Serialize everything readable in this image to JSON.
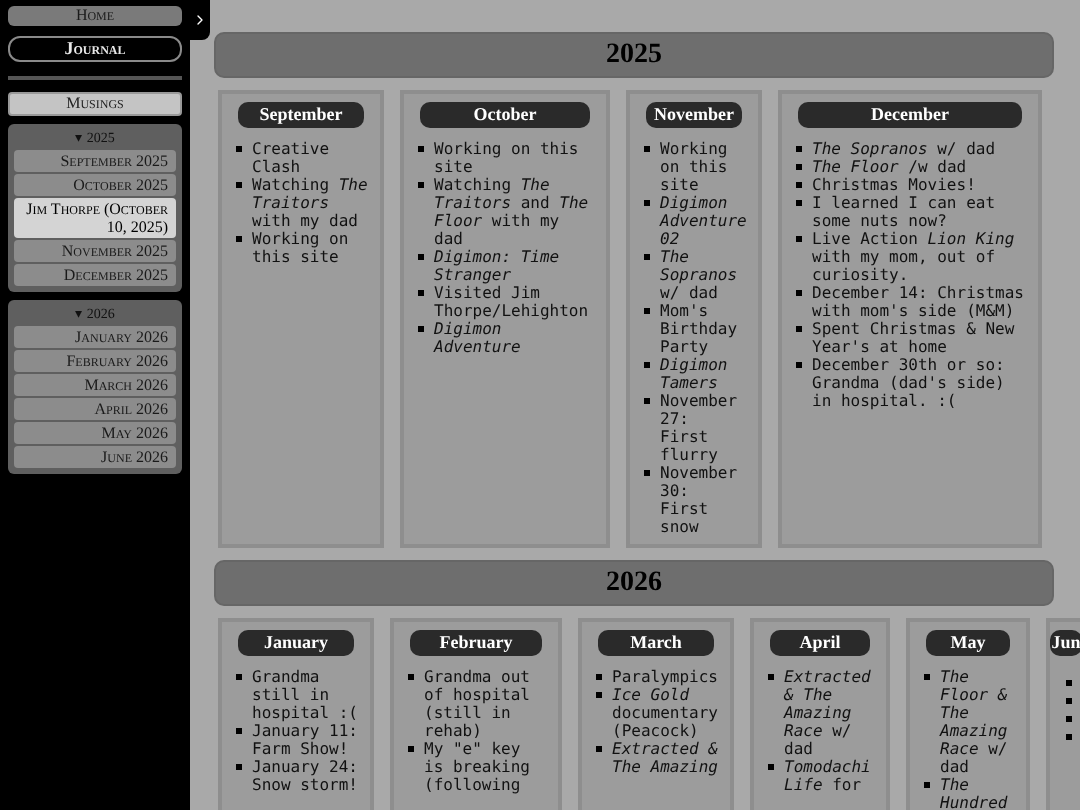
{
  "sidebar": {
    "nav": [
      {
        "label": "Home",
        "selected": false
      },
      {
        "label": "Journal",
        "selected": true
      }
    ],
    "sections": [
      {
        "label": "Musings",
        "selected": false
      }
    ],
    "groups": [
      {
        "arrow": "▾",
        "label": "2025",
        "items": [
          {
            "label": "September 2025",
            "selected": false
          },
          {
            "label": "October 2025",
            "selected": false
          },
          {
            "label": "Jim Thorpe (October 10, 2025)",
            "selected": true
          },
          {
            "label": "November 2025",
            "selected": false
          },
          {
            "label": "December 2025",
            "selected": false
          }
        ]
      },
      {
        "arrow": "▾",
        "label": "2026",
        "items": [
          {
            "label": "January 2026",
            "selected": false
          },
          {
            "label": "February 2026",
            "selected": false
          },
          {
            "label": "March 2026",
            "selected": false
          },
          {
            "label": "April 2026",
            "selected": false
          },
          {
            "label": "May 2026",
            "selected": false
          },
          {
            "label": "June 2026",
            "selected": false
          }
        ]
      }
    ]
  },
  "years": [
    {
      "title": "2025",
      "months": [
        {
          "name": "September",
          "entries": [
            "Creative Clash",
            "Watching *The Traitors* with my dad",
            "Working on this site"
          ]
        },
        {
          "name": "October",
          "entries": [
            "Working on this site",
            "Watching *The Traitors* and *The Floor* with my dad",
            "*Digimon: Time Stranger*",
            "Visited Jim Thorpe/Lehighton",
            "*Digimon Adventure*"
          ]
        },
        {
          "name": "November",
          "entries": [
            "Working on this site",
            "*Digimon Adventure 02*",
            "*The Sopranos* w/ dad",
            "Mom's Birthday Party",
            "*Digimon Tamers*",
            "November 27: First flurry",
            "November 30: First snow"
          ]
        },
        {
          "name": "December",
          "entries": [
            "*The Sopranos* w/ dad",
            "*The Floor* /w dad",
            "Christmas Movies!",
            "I learned I can eat some nuts now?",
            "Live Action *Lion King* with my mom, out of curiosity.",
            "December 14: Christmas with mom's side (M&M)",
            "Spent Christmas & New Year's at home",
            "December 30th or so: Grandma (dad's side) in hospital. :("
          ]
        }
      ]
    },
    {
      "title": "2026",
      "months": [
        {
          "name": "January",
          "entries": [
            "Grandma still in hospital :(",
            "January 11: Farm Show!",
            "January 24: Snow storm!"
          ]
        },
        {
          "name": "February",
          "entries": [
            "Grandma out of hospital (still in rehab)",
            "My \"e\" key is breaking (following"
          ]
        },
        {
          "name": "March",
          "entries": [
            "Paralympics",
            "*Ice Gold* documentary (Peacock)",
            "*Extracted & The Amazing*"
          ]
        },
        {
          "name": "April",
          "entries": [
            "*Extracted & The Amazing Race* w/ dad",
            "*Tomodachi Life* for"
          ]
        },
        {
          "name": "May",
          "entries": [
            "*The Floor & The Amazing Race* w/ dad",
            "*The Hundred*"
          ]
        },
        {
          "name": "Jun"
        }
      ]
    }
  ]
}
